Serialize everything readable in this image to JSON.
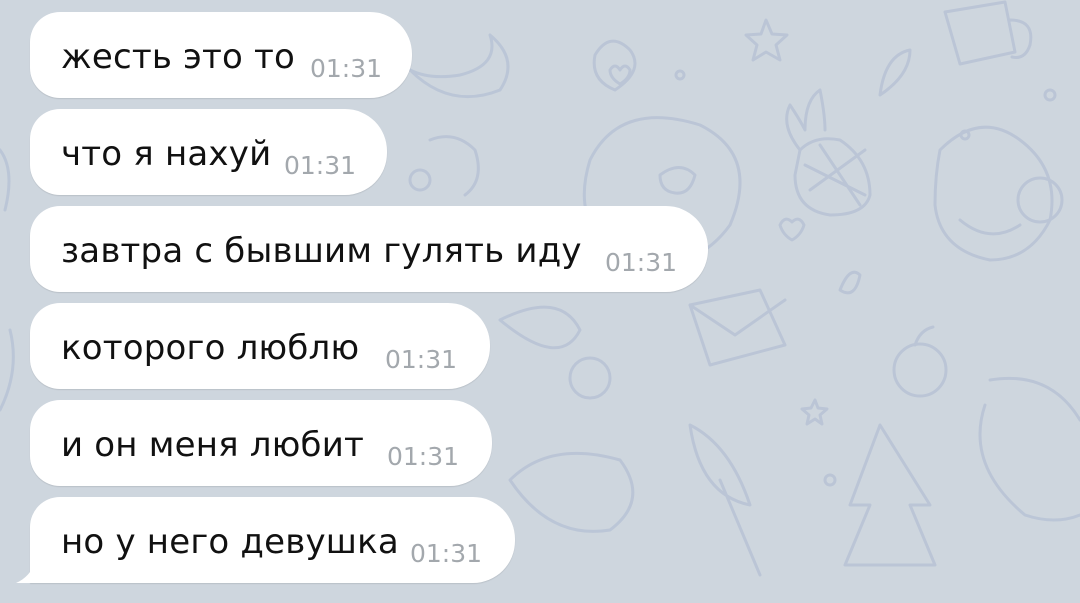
{
  "messages": [
    {
      "text": "жесть это то",
      "time": "01:31"
    },
    {
      "text": "что я нахуй",
      "time": "01:31"
    },
    {
      "text": "завтра с бывшим гулять иду",
      "time": "01:31"
    },
    {
      "text": "которого люблю",
      "time": "01:31"
    },
    {
      "text": "и он меня любит",
      "time": "01:31"
    },
    {
      "text": "но у него девушка",
      "time": "01:31"
    }
  ],
  "colors": {
    "background": "#ced6de",
    "bubble": "#ffffff",
    "text": "#111111",
    "time": "#a3a8ad"
  }
}
